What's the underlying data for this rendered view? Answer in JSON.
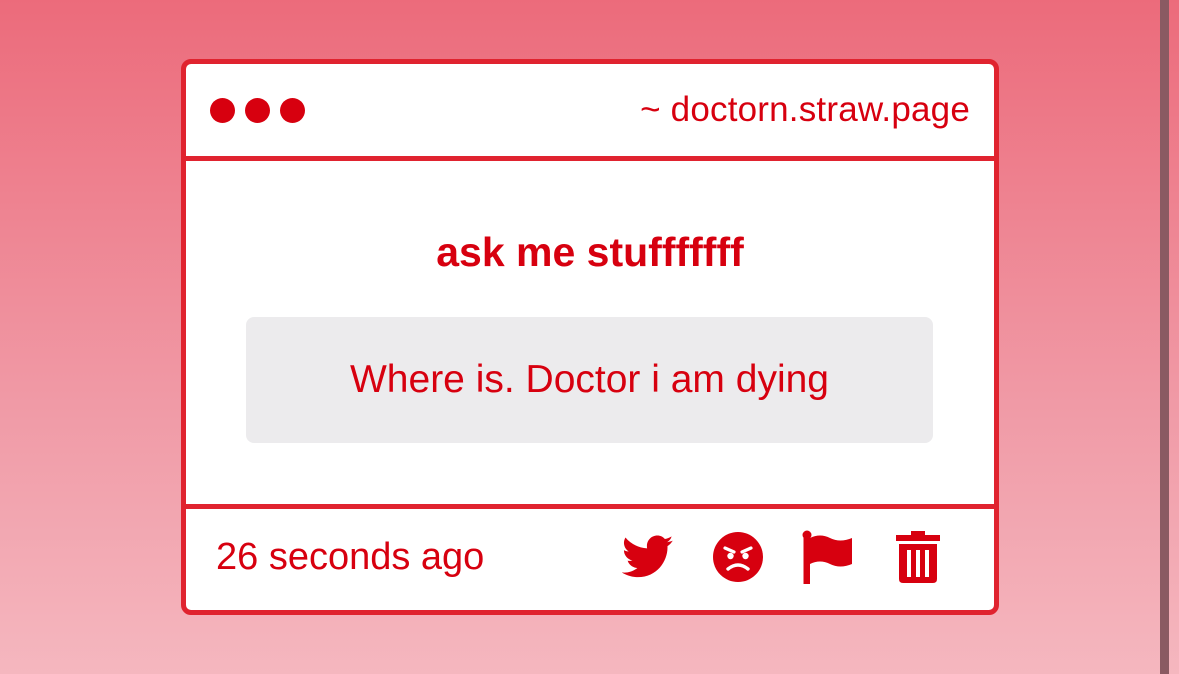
{
  "window": {
    "url": "~ doctorn.straw.page"
  },
  "card": {
    "prompt": "ask me stufffffff",
    "question": "Where is. Doctor i am dying"
  },
  "footer": {
    "timestamp": "26 seconds ago",
    "actions": [
      {
        "icon": "twitter-icon"
      },
      {
        "icon": "angry-face-icon"
      },
      {
        "icon": "flag-icon"
      },
      {
        "icon": "trash-icon"
      }
    ]
  },
  "colors": {
    "accent": "#d7000f",
    "border": "#e0232f",
    "question_bg": "#ecebed",
    "background_top": "#ec6b7b",
    "background_bottom": "#f5b7bf"
  }
}
